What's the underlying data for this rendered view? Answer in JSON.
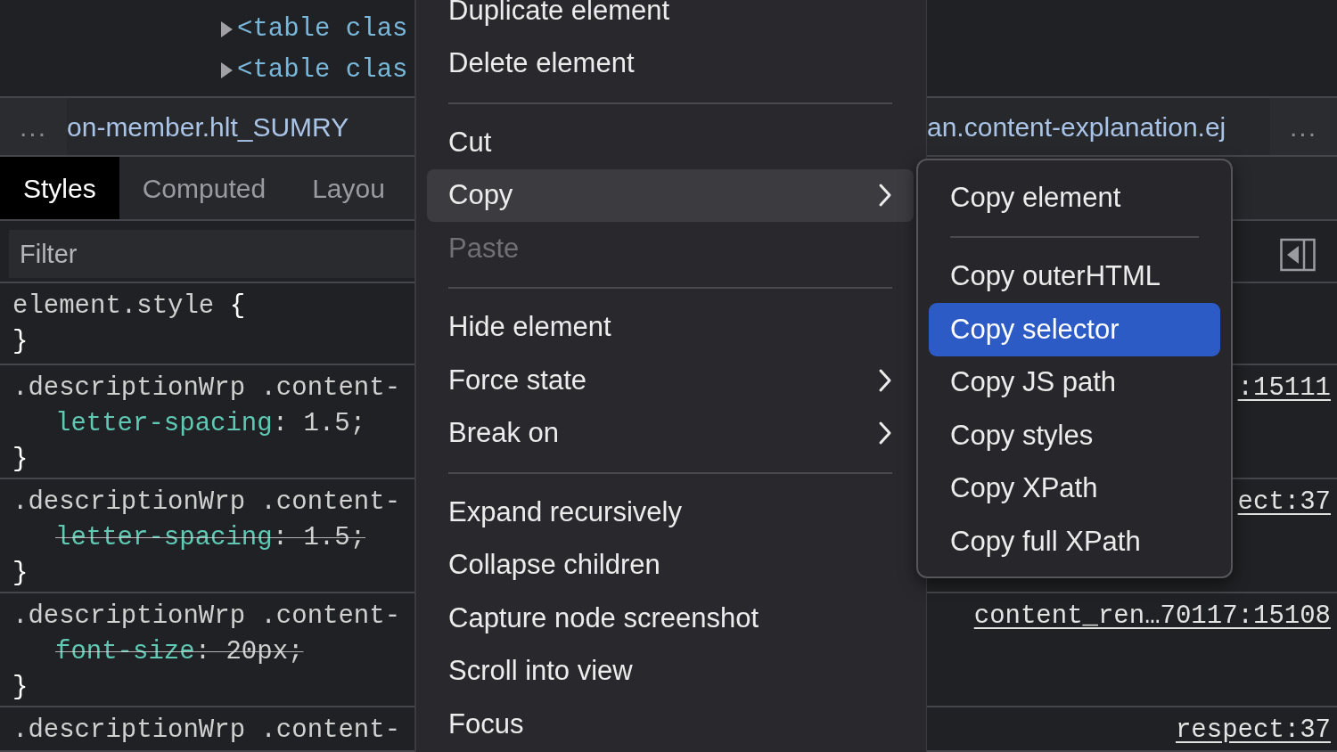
{
  "elements_tree": {
    "lines": [
      {
        "text": "<table clas",
        "expanded": false
      },
      {
        "text": "<table clas",
        "expanded": false
      }
    ]
  },
  "breadcrumbs": {
    "overflow_left": "...",
    "items": [
      {
        "text": "on-member.hlt_SUMRY"
      },
      {
        "text": "an.content-explanation.ej"
      }
    ],
    "overflow_right": "..."
  },
  "tabs": [
    {
      "label": "Styles",
      "selected": true
    },
    {
      "label": "Computed",
      "selected": false
    },
    {
      "label": "Layou",
      "selected": false
    }
  ],
  "filter": {
    "placeholder": "Filter"
  },
  "style_rules": [
    {
      "selector": "element.style",
      "brace": "{",
      "closing": "}"
    },
    {
      "selector": ".descriptionWrp .content-",
      "declarations": [
        {
          "property": "letter-spacing",
          "rest": ": 1.5;",
          "overridden": false
        }
      ],
      "closing": "}",
      "source": ":15111"
    },
    {
      "selector": ".descriptionWrp .content-",
      "declarations": [
        {
          "property": "letter-spacing",
          "rest": ": 1.5;",
          "overridden": true
        }
      ],
      "closing": "}",
      "source": "ect:37"
    },
    {
      "selector": ".descriptionWrp .content-",
      "declarations": [
        {
          "property": "font-size",
          "rest": ": 20px;",
          "overridden": true
        }
      ],
      "closing": "}",
      "source": "content_ren…70117:15108"
    },
    {
      "selector": ".descriptionWrp .content-",
      "source": "respect:37"
    }
  ],
  "context_menu": {
    "items": [
      {
        "kind": "item",
        "label": "Duplicate element",
        "highlighted": false,
        "disabled": false,
        "submenu": false
      },
      {
        "kind": "item",
        "label": "Delete element",
        "highlighted": false,
        "disabled": false,
        "submenu": false
      },
      {
        "kind": "separator"
      },
      {
        "kind": "item",
        "label": "Cut",
        "highlighted": false,
        "disabled": false,
        "submenu": false
      },
      {
        "kind": "item",
        "label": "Copy",
        "highlighted": true,
        "disabled": false,
        "submenu": true
      },
      {
        "kind": "item",
        "label": "Paste",
        "highlighted": false,
        "disabled": true,
        "submenu": false
      },
      {
        "kind": "separator"
      },
      {
        "kind": "item",
        "label": "Hide element",
        "highlighted": false,
        "disabled": false,
        "submenu": false
      },
      {
        "kind": "item",
        "label": "Force state",
        "highlighted": false,
        "disabled": false,
        "submenu": true
      },
      {
        "kind": "item",
        "label": "Break on",
        "highlighted": false,
        "disabled": false,
        "submenu": true
      },
      {
        "kind": "separator"
      },
      {
        "kind": "item",
        "label": "Expand recursively",
        "highlighted": false,
        "disabled": false,
        "submenu": false
      },
      {
        "kind": "item",
        "label": "Collapse children",
        "highlighted": false,
        "disabled": false,
        "submenu": false
      },
      {
        "kind": "item",
        "label": "Capture node screenshot",
        "highlighted": false,
        "disabled": false,
        "submenu": false
      },
      {
        "kind": "item",
        "label": "Scroll into view",
        "highlighted": false,
        "disabled": false,
        "submenu": false
      },
      {
        "kind": "item",
        "label": "Focus",
        "highlighted": false,
        "disabled": false,
        "submenu": false
      }
    ]
  },
  "copy_submenu": {
    "items": [
      {
        "kind": "item",
        "label": "Copy element",
        "selected": false
      },
      {
        "kind": "separator"
      },
      {
        "kind": "item",
        "label": "Copy outerHTML",
        "selected": false
      },
      {
        "kind": "item",
        "label": "Copy selector",
        "selected": true
      },
      {
        "kind": "item",
        "label": "Copy JS path",
        "selected": false
      },
      {
        "kind": "item",
        "label": "Copy styles",
        "selected": false
      },
      {
        "kind": "item",
        "label": "Copy XPath",
        "selected": false
      },
      {
        "kind": "item",
        "label": "Copy full XPath",
        "selected": false
      }
    ]
  }
}
